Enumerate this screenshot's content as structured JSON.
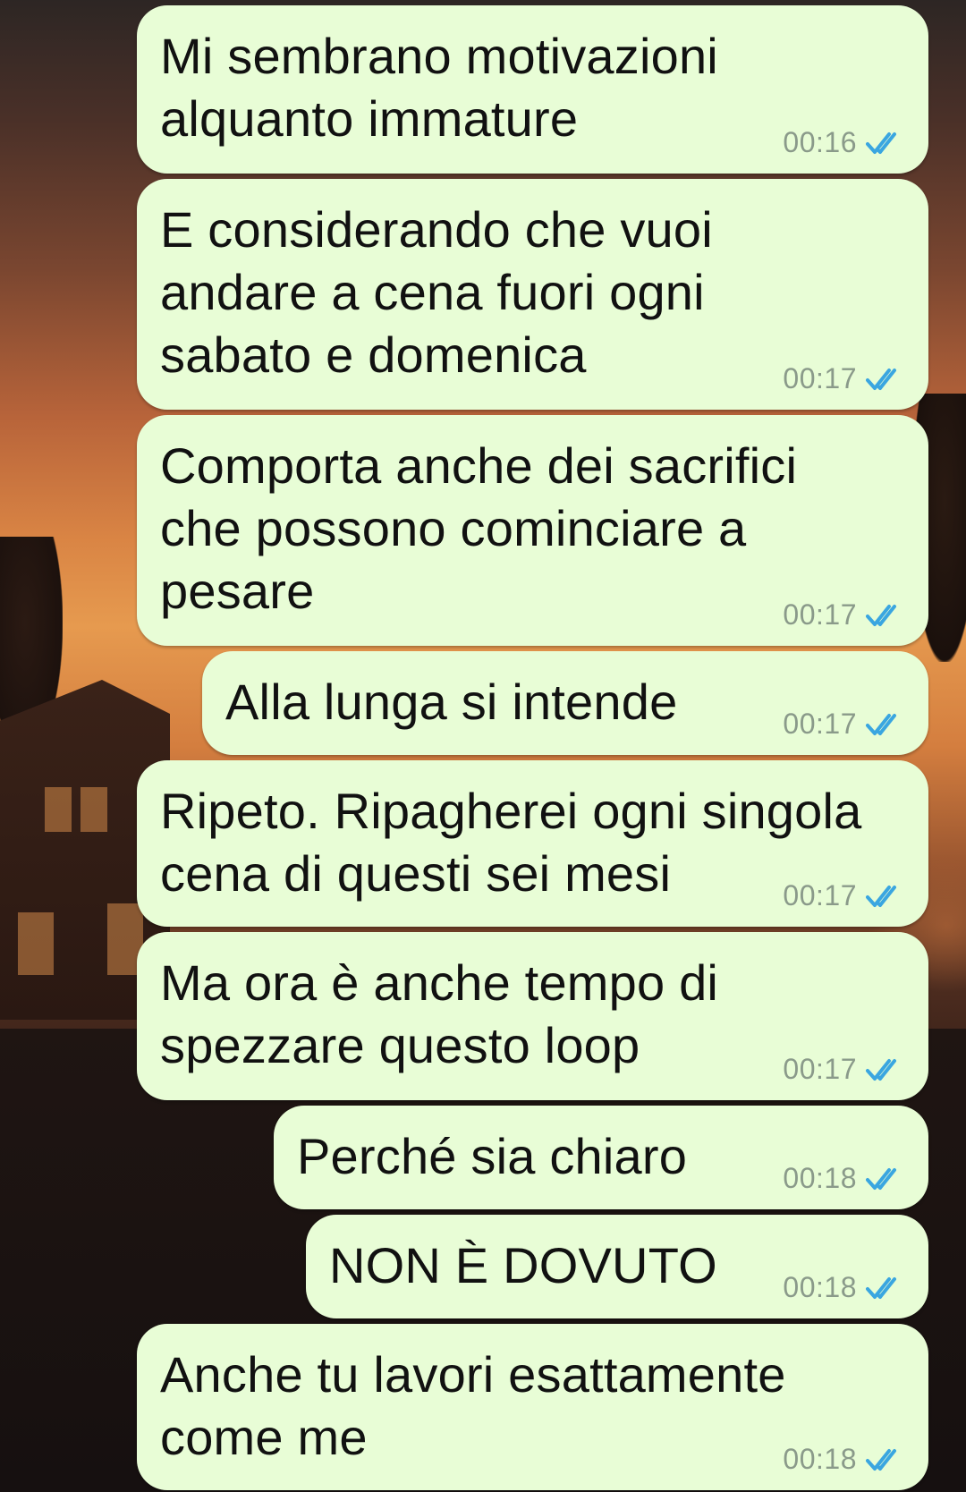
{
  "messages": [
    {
      "text": "Mi sembrano motivazioni\nalquanto immature",
      "time": "00:16",
      "status": "read"
    },
    {
      "text": "E considerando che vuoi\nandare a cena fuori ogni\nsabato e domenica",
      "time": "00:17",
      "status": "read"
    },
    {
      "text": "Comporta anche dei sacrifici\nche possono cominciare a\npesare",
      "time": "00:17",
      "status": "read"
    },
    {
      "text": "Alla lunga si intende",
      "time": "00:17",
      "status": "read"
    },
    {
      "text": "Ripeto. Ripagherei ogni singola\ncena di questi sei mesi",
      "time": "00:17",
      "status": "read"
    },
    {
      "text": "Ma ora è anche tempo di\nspezzare questo loop",
      "time": "00:17",
      "status": "read"
    },
    {
      "text": "Perché sia chiaro",
      "time": "00:18",
      "status": "read"
    },
    {
      "text": "NON È DOVUTO",
      "time": "00:18",
      "status": "read"
    },
    {
      "text": "Anche tu lavori esattamente\ncome me",
      "time": "00:18",
      "status": "read"
    }
  ],
  "icons": {
    "read_receipt": "double-check-icon"
  },
  "colors": {
    "bubble": "#e8fdd6",
    "tick": "#3aa6e0",
    "time": "#8a9a8a"
  }
}
